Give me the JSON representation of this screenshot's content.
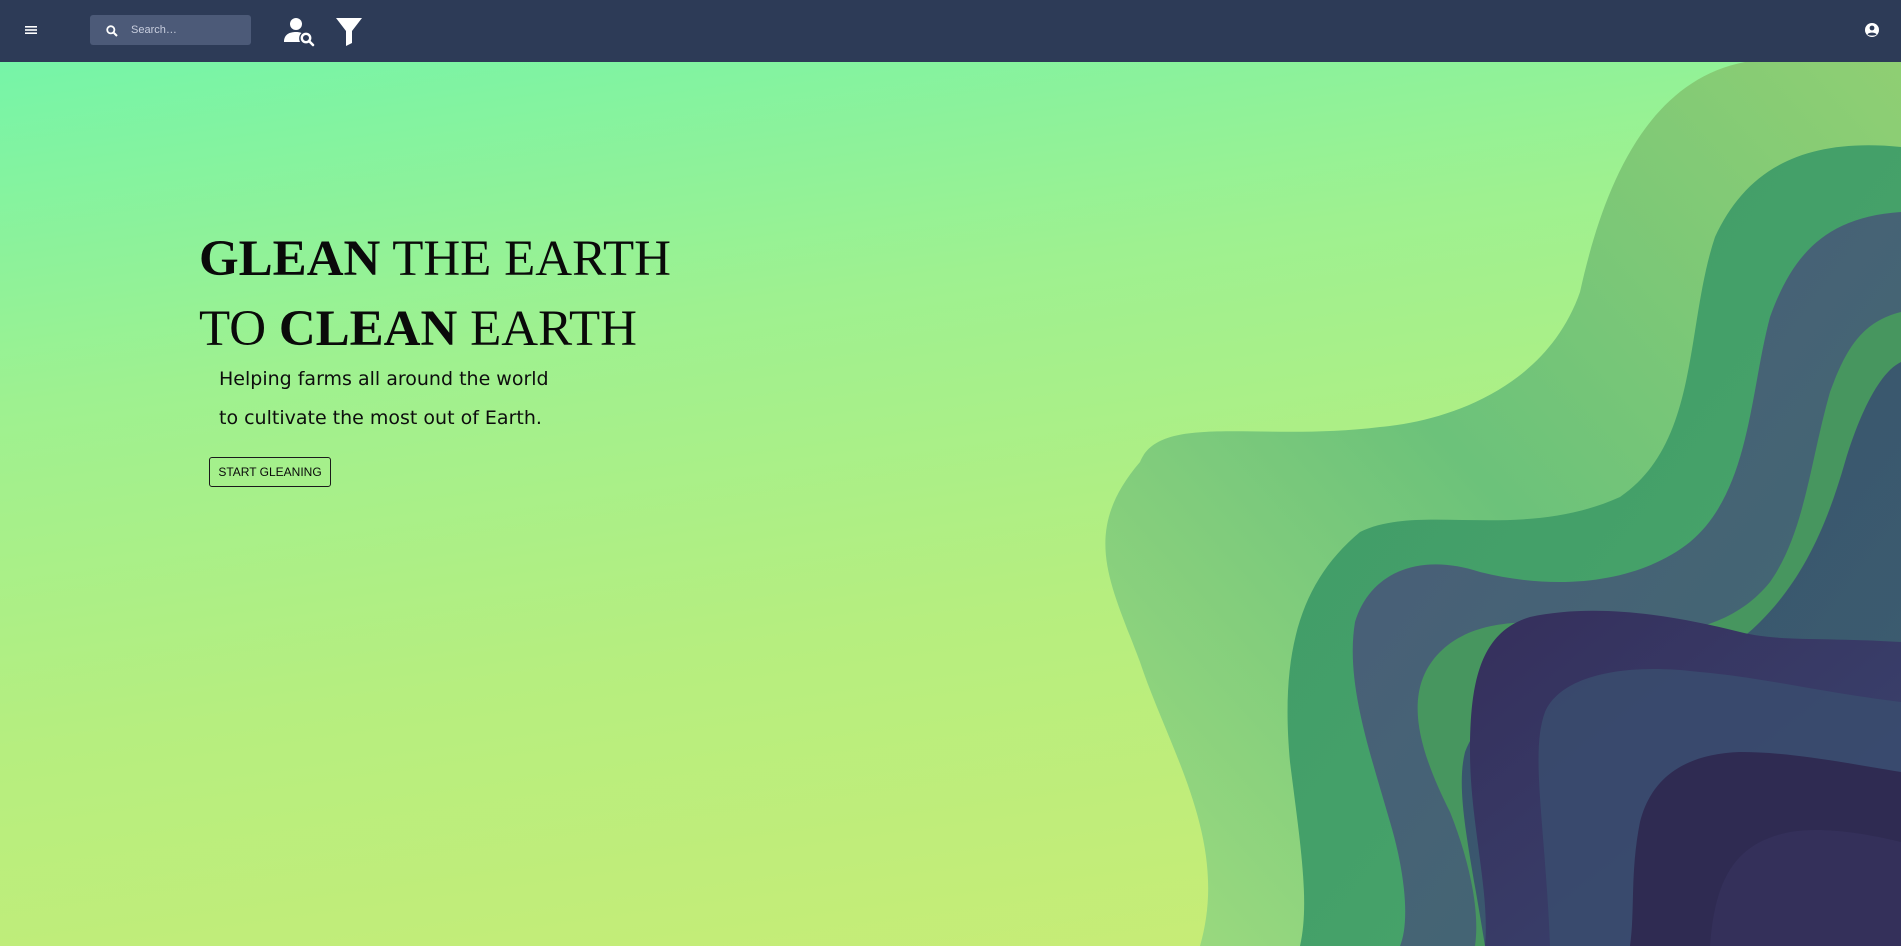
{
  "topbar": {
    "menu_icon": "hamburger-menu-icon",
    "search": {
      "placeholder": "Search…",
      "icon": "search-icon"
    },
    "people_search_icon": "person-search-icon",
    "filter_icon": "filter-icon",
    "account_icon": "account-circle-icon",
    "colors": {
      "background": "#2d3b57",
      "search_bg": "#4c5a78"
    }
  },
  "hero": {
    "headline_line1": {
      "bold": "GLEAN",
      "rest": " THE EARTH"
    },
    "headline_line2": {
      "lead": "TO ",
      "bold": "CLEAN",
      "rest": " EARTH"
    },
    "subtitle_line1": "Helping farms all around the world",
    "subtitle_line2": "to cultivate the most out of Earth.",
    "cta_label": "START GLEANING",
    "colors": {
      "gradient_top": "#76f4a8",
      "gradient_bottom": "#cbec74",
      "wave_dark": "#33305a",
      "wave_green": "#4ea56c"
    }
  }
}
